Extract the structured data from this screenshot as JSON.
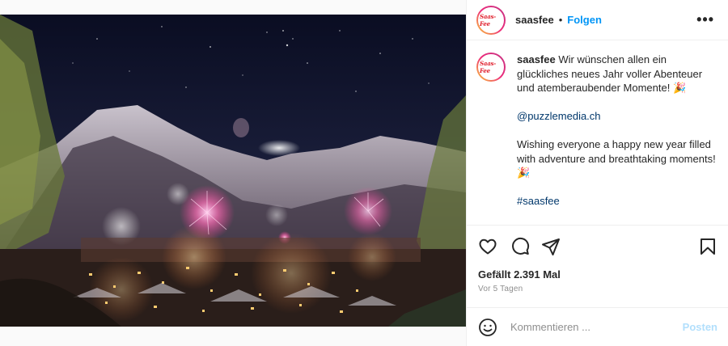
{
  "header": {
    "avatar_logo_text": "Saas-Fee",
    "username": "saasfee",
    "separator": "•",
    "follow_label": "Folgen",
    "more_label": "•••"
  },
  "caption": {
    "username": "saasfee",
    "german_text": "Wir wünschen allen ein glückliches neues Jahr voller Abenteuer und atemberaubender Momente! 🎉",
    "mention": "@puzzlemedia.ch",
    "english_text": "Wishing everyone a happy new year filled with adventure and breathtaking moments! 🎉",
    "hashtag": "#saasfee"
  },
  "actions": {
    "like_icon": "heart-icon",
    "comment_icon": "comment-icon",
    "share_icon": "share-icon",
    "save_icon": "bookmark-icon"
  },
  "stats": {
    "likes_label": "Gefällt 2.391 Mal",
    "time_label": "Vor 5 Tagen"
  },
  "comment": {
    "placeholder": "Kommentieren ...",
    "post_label": "Posten",
    "emoji_icon": "smiley-icon"
  },
  "colors": {
    "accent_blue": "#0095f6",
    "link_blue": "#00376b",
    "post_disabled": "#b2dffc",
    "brand_red": "#e01e2b"
  }
}
